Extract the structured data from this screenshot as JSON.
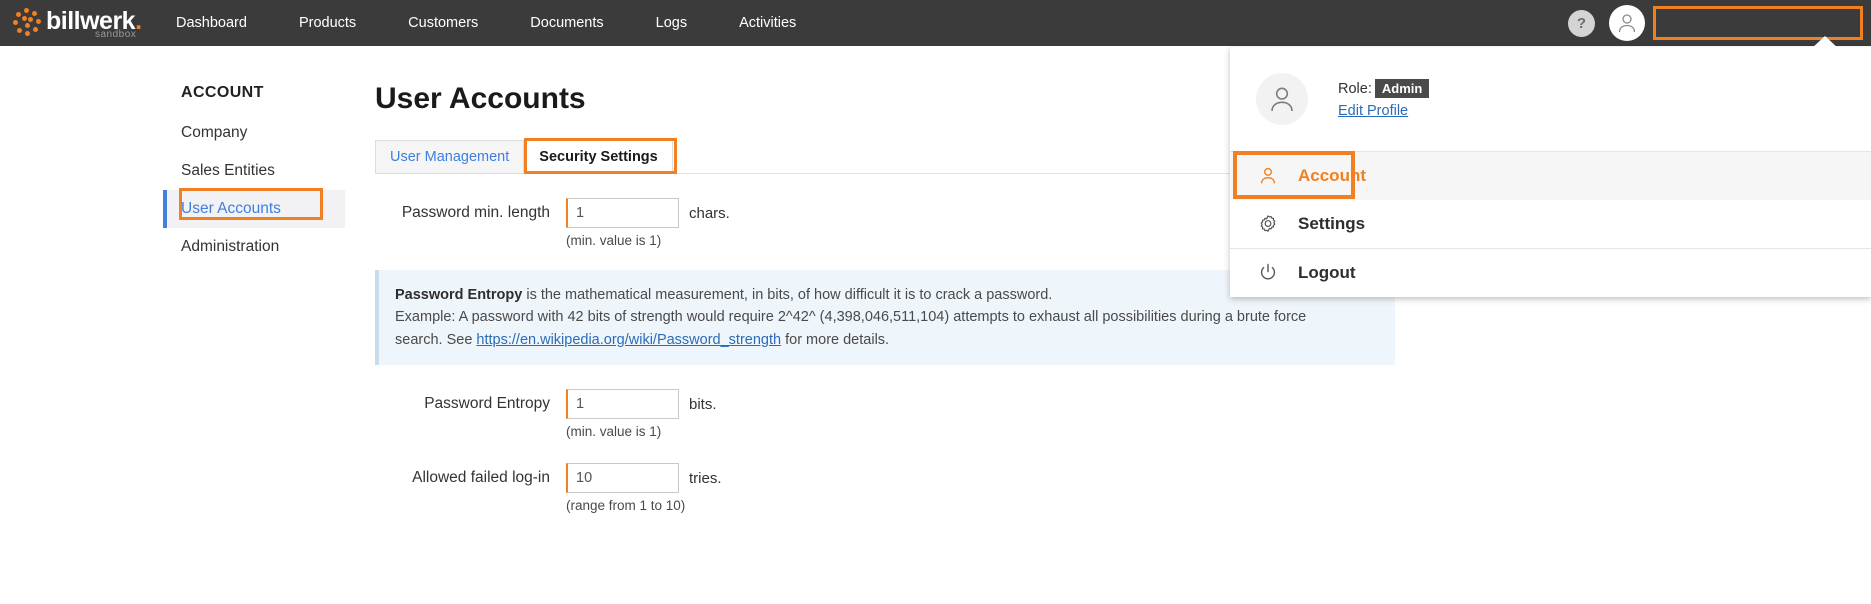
{
  "brand": {
    "name": "billwerk",
    "name_dot": ".",
    "sub": "sandbox",
    "logo_icon": "billwerk-dots-logo"
  },
  "topnav": {
    "items": [
      {
        "label": "Dashboard",
        "name": "nav-item-dashboard"
      },
      {
        "label": "Products",
        "name": "nav-item-products"
      },
      {
        "label": "Customers",
        "name": "nav-item-customers"
      },
      {
        "label": "Documents",
        "name": "nav-item-documents"
      },
      {
        "label": "Logs",
        "name": "nav-item-logs"
      },
      {
        "label": "Activities",
        "name": "nav-item-activities"
      }
    ],
    "help_label": "?",
    "user_name": ""
  },
  "user_menu": {
    "role_label": "Role:",
    "role_value": "Admin",
    "edit_profile": "Edit Profile",
    "items": [
      {
        "label": "Account",
        "icon": "user-icon"
      },
      {
        "label": "Settings",
        "icon": "gear-icon"
      },
      {
        "label": "Logout",
        "icon": "power-icon"
      }
    ]
  },
  "sidebar": {
    "title": "ACCOUNT",
    "items": [
      {
        "label": "Company"
      },
      {
        "label": "Sales Entities"
      },
      {
        "label": "User Accounts"
      },
      {
        "label": "Administration"
      }
    ]
  },
  "main": {
    "page_title": "User Accounts",
    "tabs": [
      {
        "label": "User Management"
      },
      {
        "label": "Security Settings"
      }
    ],
    "fields": [
      {
        "label": "Password min. length",
        "value": "1",
        "suffix": "chars.",
        "hint": "(min. value is 1)"
      },
      {
        "label": "Password Entropy",
        "value": "1",
        "suffix": "bits.",
        "hint": "(min. value is 1)"
      },
      {
        "label": "Allowed failed log-in",
        "value": "10",
        "suffix": "tries.",
        "hint": "(range from 1 to 10)"
      }
    ],
    "info_box": {
      "term": "Password Entropy",
      "line1_rest": " is the mathematical measurement, in bits, of how difficult it is to crack a password.",
      "line2": "Example: A password with 42 bits of strength would require 2^42^ (4,398,046,511,104) attempts to exhaust all possibilities during a brute force",
      "line3_prefix": "search. See ",
      "link_text": "https://en.wikipedia.org/wiki/Password_strength",
      "line3_suffix": " for more details."
    }
  },
  "colors": {
    "accent": "#f08022",
    "topbar": "#3b3b3b",
    "link": "#3f7fe0",
    "info_bg": "#eef5fb"
  }
}
